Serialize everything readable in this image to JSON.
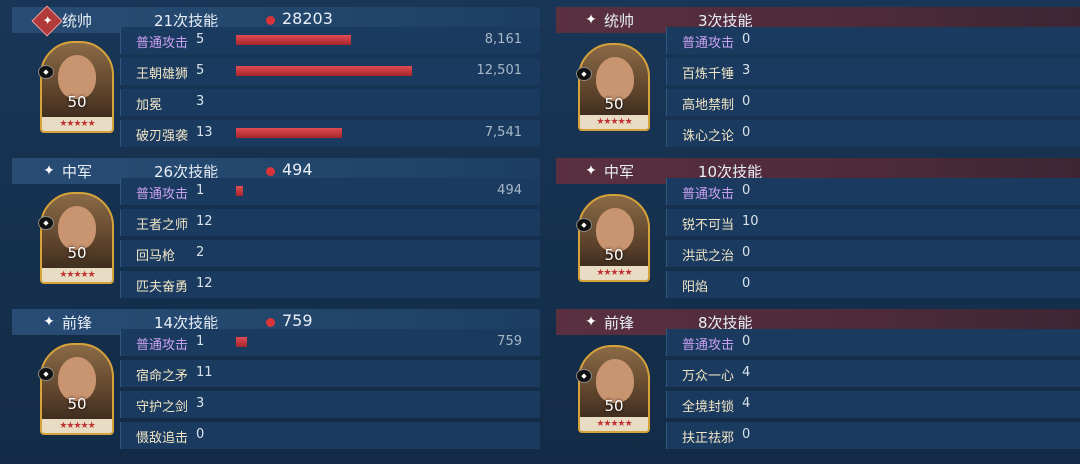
{
  "left": [
    {
      "role": "统帅",
      "icon": "diamond-command-icon",
      "skills": "21次技能",
      "damage": "28203",
      "level": "50",
      "rows": [
        {
          "name": "普通攻击",
          "count": "5",
          "value": "8,161",
          "pct": 0.653,
          "basic": true
        },
        {
          "name": "王朝雄狮",
          "count": "5",
          "value": "12,501",
          "pct": 1.0
        },
        {
          "name": "加冕",
          "count": "3",
          "value": "",
          "pct": 0
        },
        {
          "name": "破刃强袭",
          "count": "13",
          "value": "7,541",
          "pct": 0.603
        }
      ]
    },
    {
      "role": "中军",
      "icon": "sparkle-icon",
      "skills": "26次技能",
      "damage": "494",
      "level": "50",
      "rows": [
        {
          "name": "普通攻击",
          "count": "1",
          "value": "494",
          "pct": 0.04,
          "basic": true
        },
        {
          "name": "王者之师",
          "count": "12",
          "value": "",
          "pct": 0
        },
        {
          "name": "回马枪",
          "count": "2",
          "value": "",
          "pct": 0
        },
        {
          "name": "匹夫奋勇",
          "count": "12",
          "value": "",
          "pct": 0
        }
      ]
    },
    {
      "role": "前锋",
      "icon": "sparkle-icon",
      "skills": "14次技能",
      "damage": "759",
      "level": "50",
      "rows": [
        {
          "name": "普通攻击",
          "count": "1",
          "value": "759",
          "pct": 0.06,
          "basic": true
        },
        {
          "name": "宿命之矛",
          "count": "11",
          "value": "",
          "pct": 0
        },
        {
          "name": "守护之剑",
          "count": "3",
          "value": "",
          "pct": 0
        },
        {
          "name": "慑敌追击",
          "count": "0",
          "value": "",
          "pct": 0
        }
      ]
    }
  ],
  "right": [
    {
      "role": "统帅",
      "icon": "sparkle-icon",
      "skills": "3次技能",
      "level": "50",
      "rows": [
        {
          "name": "普通攻击",
          "count": "0",
          "basic": true
        },
        {
          "name": "百炼千锤",
          "count": "3"
        },
        {
          "name": "高地禁制",
          "count": "0"
        },
        {
          "name": "诛心之论",
          "count": "0"
        }
      ]
    },
    {
      "role": "中军",
      "icon": "sparkle-icon",
      "skills": "10次技能",
      "level": "50",
      "rows": [
        {
          "name": "普通攻击",
          "count": "0",
          "basic": true
        },
        {
          "name": "锐不可当",
          "count": "10"
        },
        {
          "name": "洪武之治",
          "count": "0"
        },
        {
          "name": "阳焰",
          "count": "0"
        }
      ]
    },
    {
      "role": "前锋",
      "icon": "sparkle-icon",
      "skills": "8次技能",
      "level": "50",
      "rows": [
        {
          "name": "普通攻击",
          "count": "0",
          "basic": true
        },
        {
          "name": "万众一心",
          "count": "4"
        },
        {
          "name": "全境封锁",
          "count": "4"
        },
        {
          "name": "扶正祛邪",
          "count": "0"
        }
      ]
    }
  ],
  "stars": "★★★★★",
  "badge_glyph": "◆",
  "sparkle_glyph": "✦",
  "colors": {
    "bar": "#d13a42",
    "basic_skill": "#c9a0f0",
    "portrait_border": "#d6a23a"
  }
}
